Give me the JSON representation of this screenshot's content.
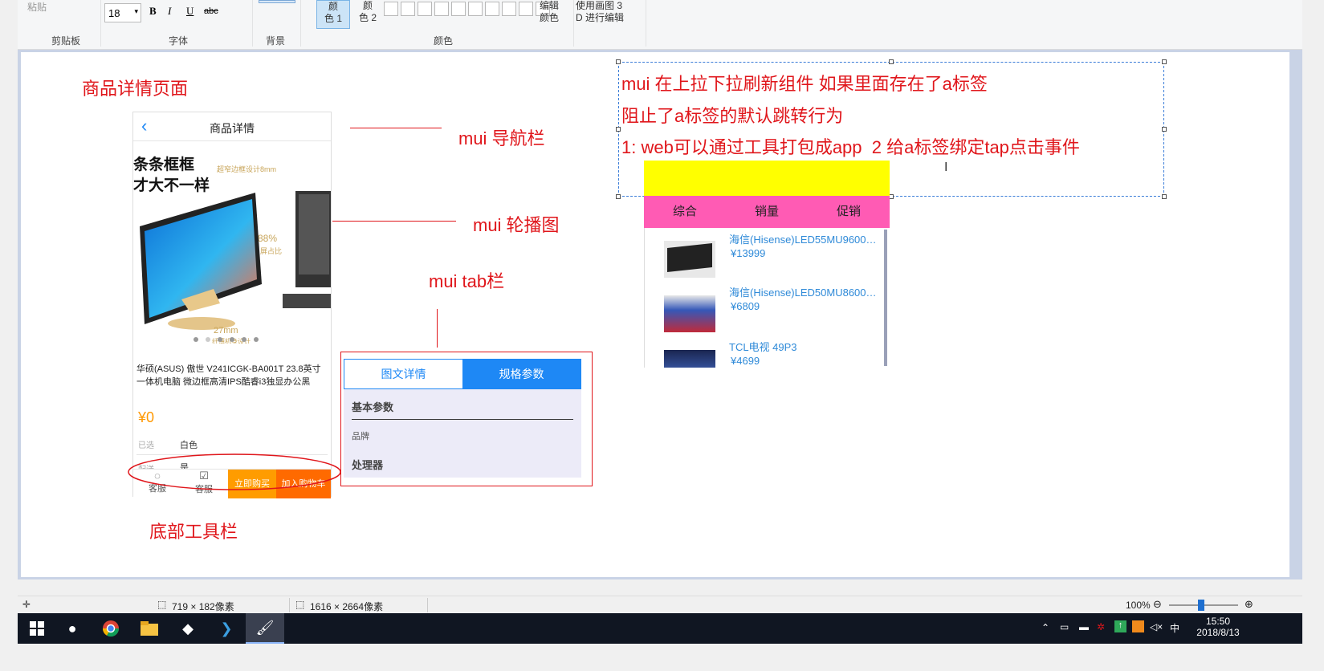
{
  "ribbon": {
    "paste": "粘贴",
    "clipboard": "剪贴板",
    "font_size": "18",
    "bold": "B",
    "italic": "I",
    "underline": "U",
    "strike": "abc",
    "font": "字体",
    "background": "背景",
    "color1_a": "颜",
    "color1_b": "色 1",
    "color2_a": "颜",
    "color2_b": "色 2",
    "edit_colors_a": "编辑",
    "edit_colors_b": "颜色",
    "paint3d_a": "使用画图 3",
    "paint3d_b": "D 进行编辑",
    "colors": "颜色"
  },
  "canvas": {
    "title_goods": "商品详情页面",
    "label_nav": "mui 导航栏",
    "label_slider": "mui 轮播图",
    "label_tab": "mui tab栏",
    "label_bottom": "底部工具栏",
    "phone": {
      "back": "‹",
      "title": "商品详情",
      "promo1": "条条框框",
      "promo2": "才大不一样",
      "promo3": "超窄边框设计8mm",
      "pct": "88%",
      "pct_sub": "屏占比",
      "bezel": "27mm",
      "bezel_sub": "纤薄机身设计",
      "desc": "华硕(ASUS) 傲世 V241ICGK-BA001T 23.8英寸一体机电脑 微边框高清IPS酷睿i3独显办公黑",
      "price": "¥0",
      "opt1_label": "已选",
      "opt1_value": "白色",
      "opt2_label": "配送",
      "opt2_value": "是",
      "btn_service1": "客服",
      "btn_service2": "客服",
      "btn_buy": "立即购买",
      "btn_cart": "加入购物车"
    },
    "tabpanel": {
      "tab1": "图文详情",
      "tab2": "规格参数",
      "row1": "基本参数",
      "row2": "品牌",
      "row3": "处理器"
    },
    "note": {
      "line1": "mui 在上拉下拉刷新组件 如果里面存在了a标签",
      "line2": "阻止了a标签的默认跳转行为",
      "line3": "1: web可以通过工具打包成app  2 给a标签绑定tap点击事件"
    },
    "list": {
      "tabs": [
        "综合",
        "销量",
        "促销"
      ],
      "items": [
        {
          "name": "海信(Hisense)LED55MU9600…",
          "price": "¥13999"
        },
        {
          "name": "海信(Hisense)LED50MU8600…",
          "price": "¥6809"
        },
        {
          "name": "TCL电视 49P3",
          "price": "¥4699"
        }
      ]
    }
  },
  "status": {
    "selection": "719 × 182像素",
    "image_size": "1616 × 2664像素",
    "zoom": "100%"
  },
  "taskbar": {
    "time": "15:50",
    "date": "2018/8/13",
    "ime": "中"
  },
  "colors": {
    "annotation_red": "#e0161b",
    "tab_blue": "#1e88f5",
    "yellow": "#ffff00",
    "pink": "#ff5bb4",
    "orange": "#ff9800"
  }
}
